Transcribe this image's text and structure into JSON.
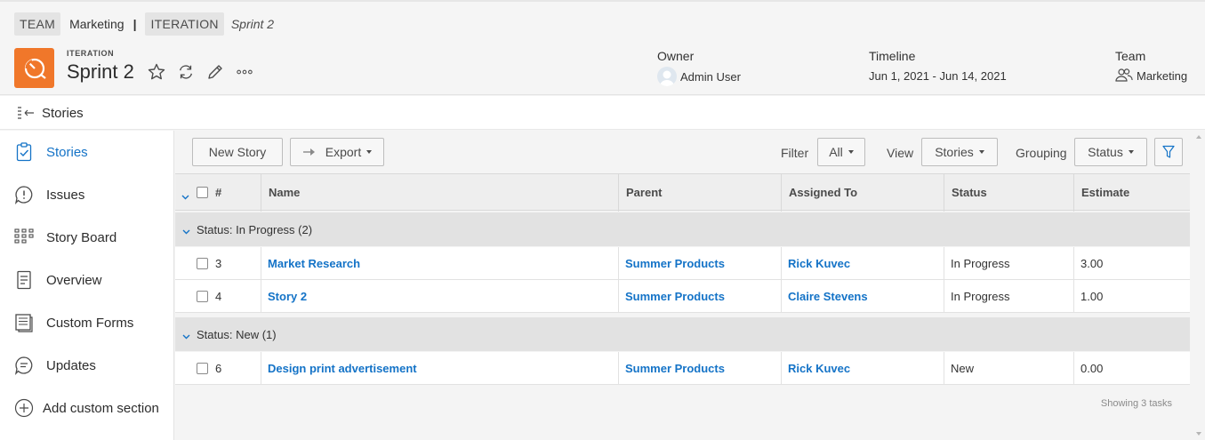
{
  "breadcrumb": {
    "team_tag": "TEAM",
    "team_name": "Marketing",
    "separator": "|",
    "iteration_tag": "ITERATION",
    "current": "Sprint 2"
  },
  "object": {
    "type_label": "ITERATION",
    "title": "Sprint 2",
    "icon": "iteration-icon",
    "icon_color": "#f0772a"
  },
  "meta": {
    "owner_label": "Owner",
    "owner_value": "Admin User",
    "timeline_label": "Timeline",
    "timeline_value": "Jun 1, 2021 - Jun 14, 2021",
    "team_label": "Team",
    "team_value": "Marketing"
  },
  "subheader": {
    "label": "Stories"
  },
  "nav": [
    {
      "label": "Stories",
      "icon": "clipboard-check-icon",
      "active": true
    },
    {
      "label": "Issues",
      "icon": "issue-bubble-icon",
      "active": false
    },
    {
      "label": "Story Board",
      "icon": "board-grid-icon",
      "active": false
    },
    {
      "label": "Overview",
      "icon": "document-icon",
      "active": false
    },
    {
      "label": "Custom Forms",
      "icon": "forms-icon",
      "active": false
    },
    {
      "label": "Updates",
      "icon": "chat-bubble-icon",
      "active": false
    },
    {
      "label": "Add custom section",
      "icon": "plus-circle-icon",
      "active": false
    }
  ],
  "toolbar": {
    "new_story": "New Story",
    "export": "Export",
    "filter_label": "Filter",
    "filter_value": "All",
    "view_label": "View",
    "view_value": "Stories",
    "grouping_label": "Grouping",
    "grouping_value": "Status"
  },
  "table": {
    "columns": [
      "#",
      "Name",
      "Parent",
      "Assigned To",
      "Status",
      "Estimate"
    ],
    "groups": [
      {
        "label": "Status: In Progress (2)",
        "rows": [
          {
            "num": "3",
            "name": "Market Research",
            "parent": "Summer Products",
            "assigned": "Rick Kuvec",
            "status": "In Progress",
            "estimate": "3.00"
          },
          {
            "num": "4",
            "name": "Story 2",
            "parent": "Summer Products",
            "assigned": "Claire Stevens",
            "status": "In Progress",
            "estimate": "1.00"
          }
        ]
      },
      {
        "label": "Status: New (1)",
        "rows": [
          {
            "num": "6",
            "name": "Design print advertisement",
            "parent": "Summer Products",
            "assigned": "Rick Kuvec",
            "status": "New",
            "estimate": "0.00"
          }
        ]
      }
    ],
    "footer": "Showing 3 tasks"
  },
  "colors": {
    "link": "#1473c7",
    "accent_orange": "#f0772a",
    "group_bg": "#e2e2e2"
  }
}
